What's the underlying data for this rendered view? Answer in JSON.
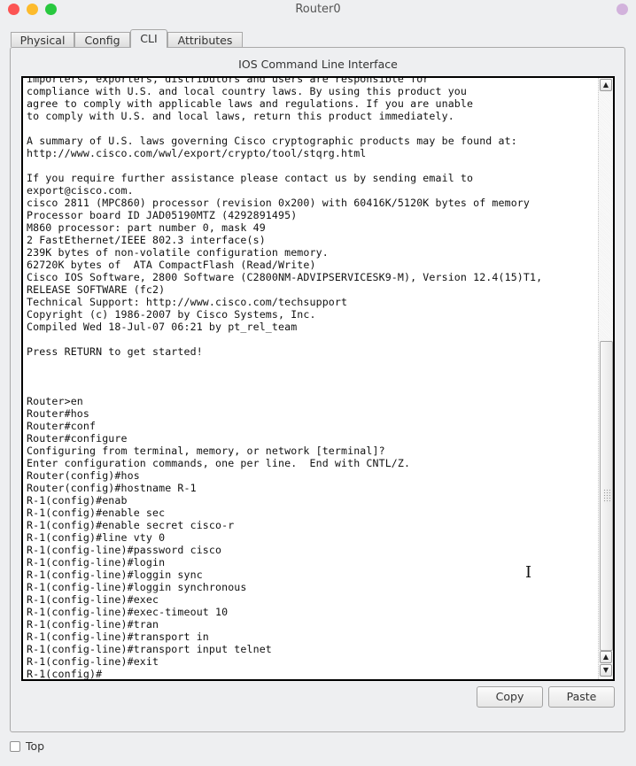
{
  "window": {
    "title": "Router0",
    "controls": [
      "close",
      "minimize",
      "maximize"
    ]
  },
  "tabs": [
    {
      "label": "Physical",
      "active": false
    },
    {
      "label": "Config",
      "active": false
    },
    {
      "label": "CLI",
      "active": true
    },
    {
      "label": "Attributes",
      "active": false
    }
  ],
  "panel": {
    "title": "IOS Command Line Interface"
  },
  "terminal": {
    "lines": [
      "importers, exporters, distributors and users are responsible for",
      "compliance with U.S. and local country laws. By using this product you",
      "agree to comply with applicable laws and regulations. If you are unable",
      "to comply with U.S. and local laws, return this product immediately.",
      "",
      "A summary of U.S. laws governing Cisco cryptographic products may be found at:",
      "http://www.cisco.com/wwl/export/crypto/tool/stqrg.html",
      "",
      "If you require further assistance please contact us by sending email to",
      "export@cisco.com.",
      "cisco 2811 (MPC860) processor (revision 0x200) with 60416K/5120K bytes of memory",
      "Processor board ID JAD05190MTZ (4292891495)",
      "M860 processor: part number 0, mask 49",
      "2 FastEthernet/IEEE 802.3 interface(s)",
      "239K bytes of non-volatile configuration memory.",
      "62720K bytes of  ATA CompactFlash (Read/Write)",
      "Cisco IOS Software, 2800 Software (C2800NM-ADVIPSERVICESK9-M), Version 12.4(15)T1,",
      "RELEASE SOFTWARE (fc2)",
      "Technical Support: http://www.cisco.com/techsupport",
      "Copyright (c) 1986-2007 by Cisco Systems, Inc.",
      "Compiled Wed 18-Jul-07 06:21 by pt_rel_team",
      "",
      "Press RETURN to get started!",
      "",
      "",
      "",
      "Router>en",
      "Router#hos",
      "Router#conf",
      "Router#configure",
      "Configuring from terminal, memory, or network [terminal]?",
      "Enter configuration commands, one per line.  End with CNTL/Z.",
      "Router(config)#hos",
      "Router(config)#hostname R-1",
      "R-1(config)#enab",
      "R-1(config)#enable sec",
      "R-1(config)#enable secret cisco-r",
      "R-1(config)#line vty 0",
      "R-1(config-line)#password cisco",
      "R-1(config-line)#login",
      "R-1(config-line)#loggin sync",
      "R-1(config-line)#loggin synchronous",
      "R-1(config-line)#exec",
      "R-1(config-line)#exec-timeout 10",
      "R-1(config-line)#tran",
      "R-1(config-line)#transport in",
      "R-1(config-line)#transport input telnet",
      "R-1(config-line)#exit",
      "R-1(config)#"
    ],
    "scroll_position_fraction": 1.0
  },
  "buttons": {
    "copy": "Copy",
    "paste": "Paste"
  },
  "top_checkbox": {
    "label": "Top",
    "checked": false
  },
  "icons": {
    "scroll_up": "▲",
    "scroll_down": "▼",
    "text_cursor": "I"
  }
}
